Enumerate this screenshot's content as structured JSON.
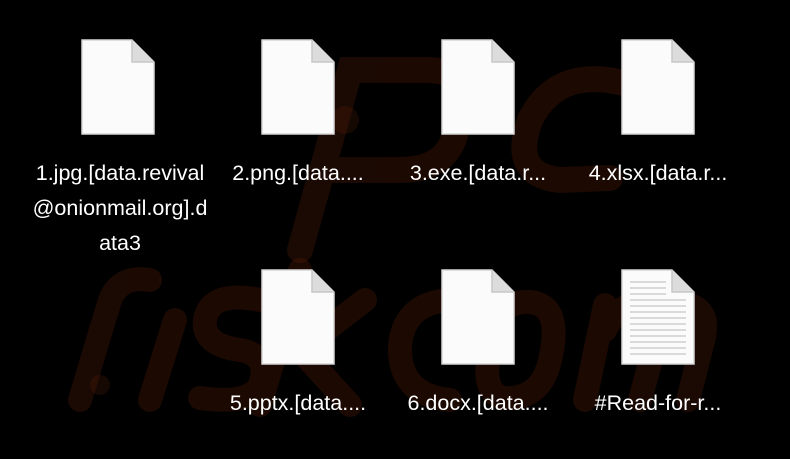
{
  "files": [
    {
      "name": "1.jpg.[data.revival@onionmail.org].data3",
      "icon": "blank-document-icon"
    },
    {
      "name": "2.png.[data....",
      "icon": "blank-document-icon"
    },
    {
      "name": "3.exe.[data.r...",
      "icon": "blank-document-icon"
    },
    {
      "name": "4.xlsx.[data.r...",
      "icon": "blank-document-icon"
    },
    {
      "name": "5.pptx.[data....",
      "icon": "blank-document-icon"
    },
    {
      "name": "6.docx.[data....",
      "icon": "blank-document-icon"
    },
    {
      "name": "#Read-for-r...",
      "icon": "text-document-icon"
    }
  ],
  "colors": {
    "background": "#000000",
    "text": "#ffffff",
    "icon_page": "#fbfbfb",
    "icon_fold": "#dcdcdc",
    "watermark": "#7a2a0c"
  }
}
